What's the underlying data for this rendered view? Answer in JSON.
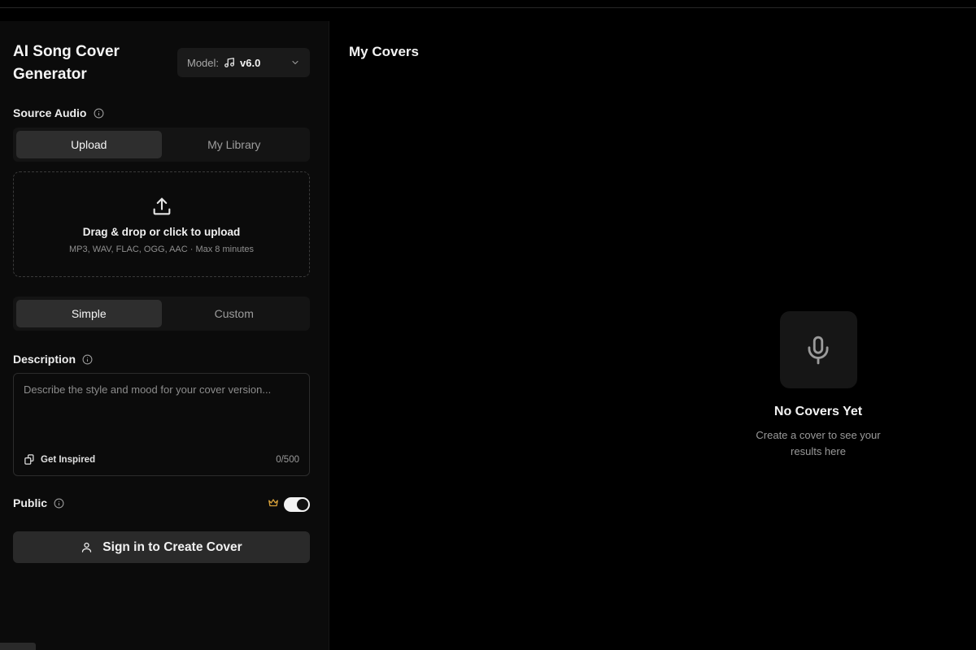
{
  "app": {
    "title": "AI Song Cover Generator",
    "model_label": "Model:",
    "model_version": "v6.0"
  },
  "source_audio": {
    "label": "Source Audio",
    "tabs": [
      {
        "label": "Upload",
        "active": true
      },
      {
        "label": "My Library",
        "active": false
      }
    ],
    "dropzone": {
      "title": "Drag & drop or click to upload",
      "formats": "MP3, WAV, FLAC, OGG, AAC · Max 8 minutes"
    }
  },
  "mode": {
    "tabs": [
      {
        "label": "Simple",
        "active": true
      },
      {
        "label": "Custom",
        "active": false
      }
    ]
  },
  "description": {
    "label": "Description",
    "placeholder": "Describe the style and mood for your cover version...",
    "value": "",
    "inspire_label": "Get Inspired",
    "counter": "0/500"
  },
  "public": {
    "label": "Public",
    "enabled": true
  },
  "signin_button": {
    "label": "Sign in to Create Cover"
  },
  "covers": {
    "title": "My Covers",
    "empty_title": "No Covers Yet",
    "empty_subtitle": "Create a cover to see your results here"
  },
  "icons": {
    "info": "info-icon",
    "music": "music-note-icon",
    "chevron": "chevron-down-icon",
    "upload": "upload-icon",
    "inspire": "sparkle-cards-icon",
    "crown": "crown-icon",
    "user": "user-icon",
    "mic": "microphone-icon"
  },
  "colors": {
    "background": "#000000",
    "panel": "#0b0b0b",
    "control": "#1a1a1a",
    "active_tab": "#2e2e2e",
    "accent_crown": "#d9a23b"
  }
}
